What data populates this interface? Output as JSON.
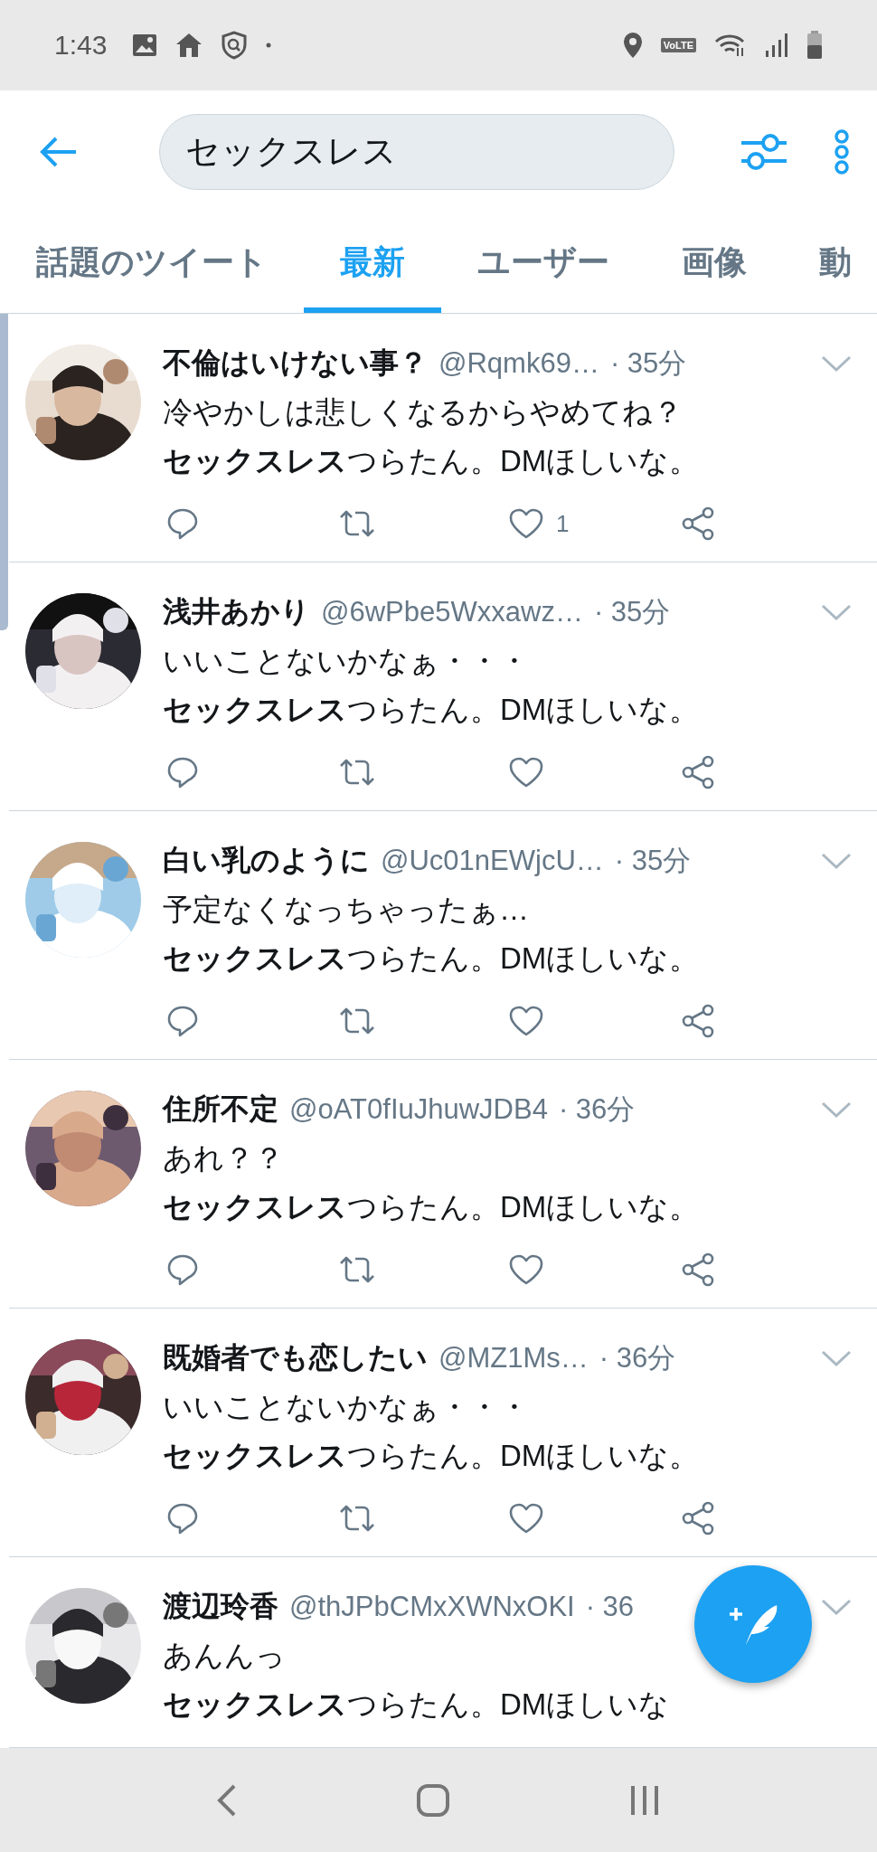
{
  "status_bar": {
    "time": "1:43",
    "network_badge": "VoLTE"
  },
  "search": {
    "value": "セックスレス"
  },
  "tabs": [
    {
      "label": "話題のツイート",
      "selected": false
    },
    {
      "label": "最新",
      "selected": true
    },
    {
      "label": "ユーザー",
      "selected": false
    },
    {
      "label": "画像",
      "selected": false
    },
    {
      "label": "動",
      "selected": false
    }
  ],
  "tweets": [
    {
      "name": "不倫はいけない事？",
      "handle": "@Rqmk69…",
      "time": "· 35分",
      "lines": [
        "冷やかしは悲しくなるからやめてね？",
        "**セックスレス**つらたん。DMほしいな。"
      ],
      "like_count": "1",
      "actions": true
    },
    {
      "name": "浅井あかり",
      "handle": "@6wPbe5Wxxawz…",
      "time": "· 35分",
      "lines": [
        "いいことないかなぁ・・・",
        "**セックスレス**つらたん。DMほしいな。"
      ],
      "actions": true
    },
    {
      "name": "白い乳のように",
      "handle": "@Uc01nEWjcU…",
      "time": "· 35分",
      "lines": [
        "予定なくなっちゃったぁ…",
        "**セックスレス**つらたん。DMほしいな。"
      ],
      "actions": true
    },
    {
      "name": "住所不定",
      "handle": "@oAT0fIuJhuwJDB4",
      "time": "· 36分",
      "lines": [
        "あれ？？",
        "**セックスレス**つらたん。DMほしいな。"
      ],
      "actions": true
    },
    {
      "name": "既婚者でも恋したい",
      "handle": "@MZ1Ms…",
      "time": "· 36分",
      "lines": [
        "いいことないかなぁ・・・",
        "**セックスレス**つらたん。DMほしいな。"
      ],
      "actions": true
    },
    {
      "name": "渡辺玲香",
      "handle": "@thJPbCMxXWNxOKI",
      "time": "· 36",
      "lines": [
        "あんんっ",
        "**セックスレス**つらたん。DMほしいな"
      ],
      "actions": false
    }
  ]
}
